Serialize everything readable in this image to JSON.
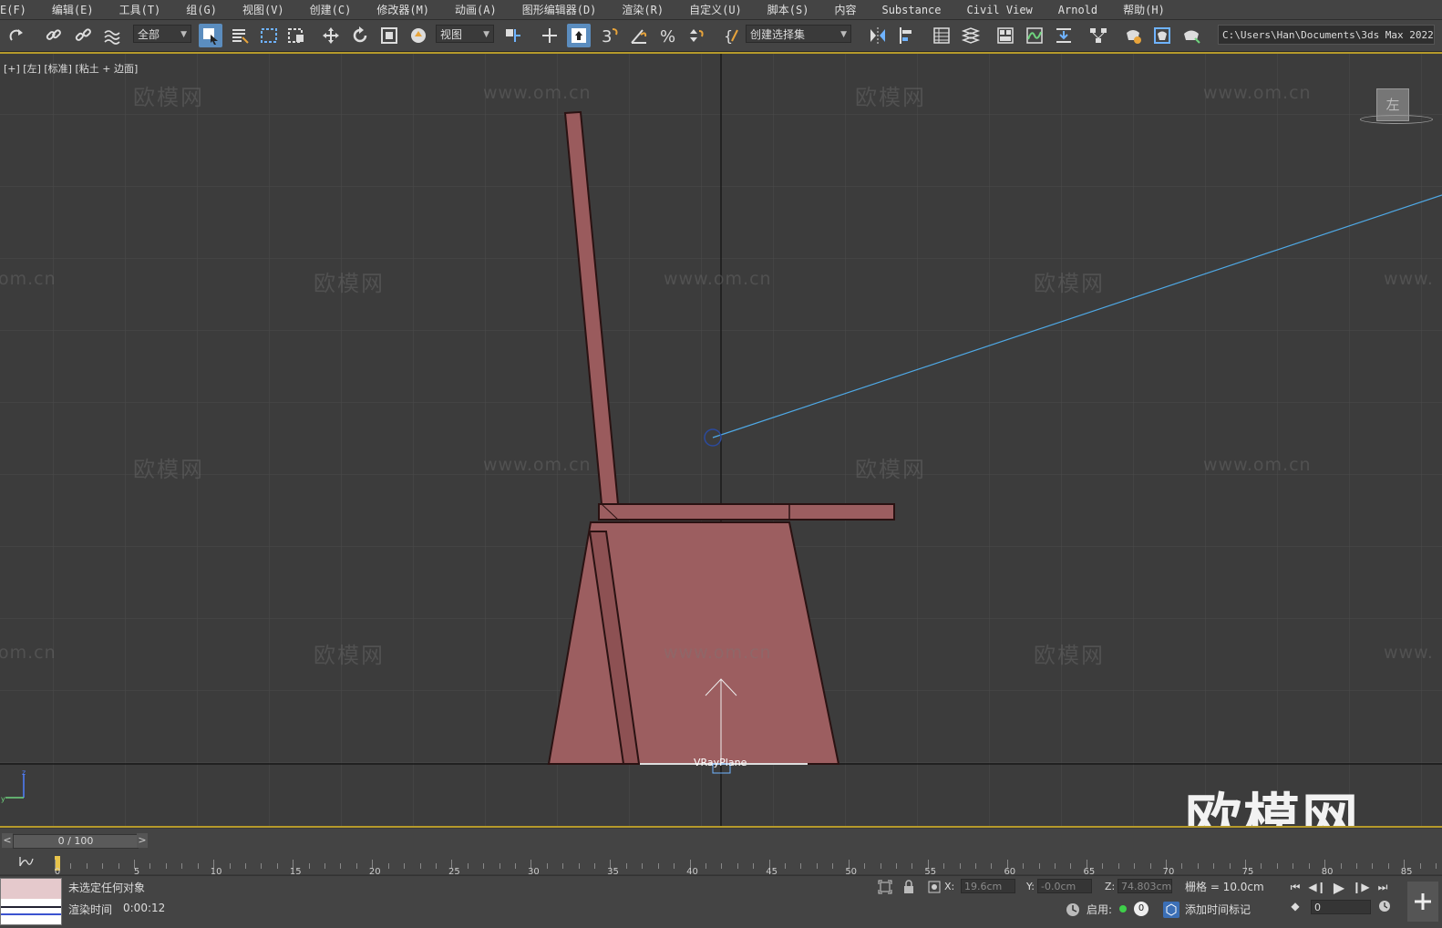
{
  "menu": [
    "E(F)",
    "编辑(E)",
    "工具(T)",
    "组(G)",
    "视图(V)",
    "创建(C)",
    "修改器(M)",
    "动画(A)",
    "图形编辑器(D)",
    "渲染(R)",
    "自定义(U)",
    "脚本(S)",
    "内容",
    "Substance",
    "Civil View",
    "Arnold",
    "帮助(H)"
  ],
  "toolbar": {
    "filter_label": "全部",
    "refcoord_label": "视图",
    "selset_label": "创建选择集",
    "path_label": "C:\\Users\\Han\\Documents\\3ds Max 2022"
  },
  "viewport": {
    "label": "[+] [左] [标准] [粘土 + 边面]",
    "object_label": "VRayPlane",
    "viewcube_label": "左",
    "watermark_cn": "欧模网",
    "watermark_url": "www.om.cn",
    "watermark_url_partial": "om.cn",
    "watermark_url_partial2": "www.",
    "corner_logo": "欧模网",
    "colors": {
      "chair": "#9c5e60",
      "chair_outline": "#2a1212",
      "light_line": "#4fa9e6"
    }
  },
  "timeline": {
    "frame_indicator": "0 / 100",
    "prev": "<",
    "next": ">",
    "ticks": [
      0,
      5,
      10,
      15,
      20,
      25,
      30,
      35,
      40,
      45,
      50,
      55,
      60,
      65,
      70,
      75,
      80,
      85
    ]
  },
  "status": {
    "selection": "未选定任何对象",
    "render_time_label": "渲染时间",
    "render_time": "0:00:12",
    "x_label": "X:",
    "x_value": "19.6cm",
    "y_label": "Y:",
    "y_value": "-0.0cm",
    "z_label": "Z:",
    "z_value": "74.803cm",
    "grid": "栅格 = 10.0cm",
    "enable_label": "启用:",
    "enable_value": "0",
    "add_time_tag": "添加时间标记",
    "frame_value": "0"
  }
}
